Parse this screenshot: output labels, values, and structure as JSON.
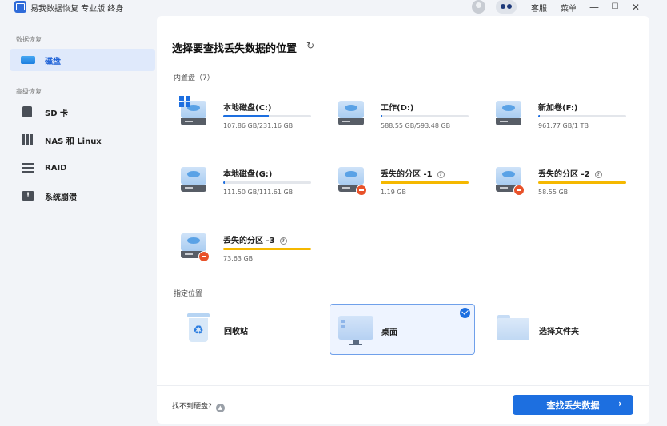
{
  "app": {
    "title": "易我数据恢复 专业版 终身",
    "links": {
      "service": "客服",
      "menu": "菜单"
    },
    "window": {
      "minimize": "—",
      "maximize": "☐",
      "close": "✕"
    }
  },
  "sidebar": {
    "section_data": "数据恢复",
    "section_advanced": "高级恢复",
    "items": [
      {
        "label": "磁盘",
        "icon": "disk-icon",
        "active": true
      },
      {
        "label": "SD 卡",
        "icon": "sd-card-icon"
      },
      {
        "label": "NAS 和 Linux",
        "icon": "nas-icon"
      },
      {
        "label": "RAID",
        "icon": "raid-icon"
      },
      {
        "label": "系统崩溃",
        "icon": "system-crash-icon"
      }
    ]
  },
  "main": {
    "title": "选择要查找丢失数据的位置",
    "builtin_label": "内置盘（7）",
    "drives": [
      {
        "name": "本地磁盘(C:)",
        "size": "107.86 GB/231.16 GB",
        "usage": 0.47,
        "type": "system"
      },
      {
        "name": "工作(D:)",
        "size": "588.55 GB/593.48 GB",
        "usage": 0.02,
        "type": "normal"
      },
      {
        "name": "新加卷(F:)",
        "size": "961.77 GB/1 TB",
        "usage": 0.01,
        "type": "normal"
      },
      {
        "name": "本地磁盘(G:)",
        "size": "111.50 GB/111.61 GB",
        "usage": 0.01,
        "type": "normal"
      },
      {
        "name": "丢失的分区 -1",
        "size": "1.19 GB",
        "usage": 1.0,
        "type": "lost"
      },
      {
        "name": "丢失的分区 -2",
        "size": "58.55 GB",
        "usage": 1.0,
        "type": "lost"
      },
      {
        "name": "丢失的分区 -3",
        "size": "73.63 GB",
        "usage": 1.0,
        "type": "lost"
      }
    ],
    "locations_label": "指定位置",
    "locations": [
      {
        "label": "回收站",
        "icon": "recycle-bin-icon"
      },
      {
        "label": "桌面",
        "icon": "desktop-icon",
        "selected": true
      },
      {
        "label": "选择文件夹",
        "icon": "folder-icon"
      }
    ]
  },
  "footer": {
    "cant_find": "找不到硬盘?",
    "primary_button": "查找丢失数据"
  },
  "colors": {
    "accent": "#1d6fe0",
    "lost": "#f5b800",
    "lost_badge": "#e8522a"
  }
}
